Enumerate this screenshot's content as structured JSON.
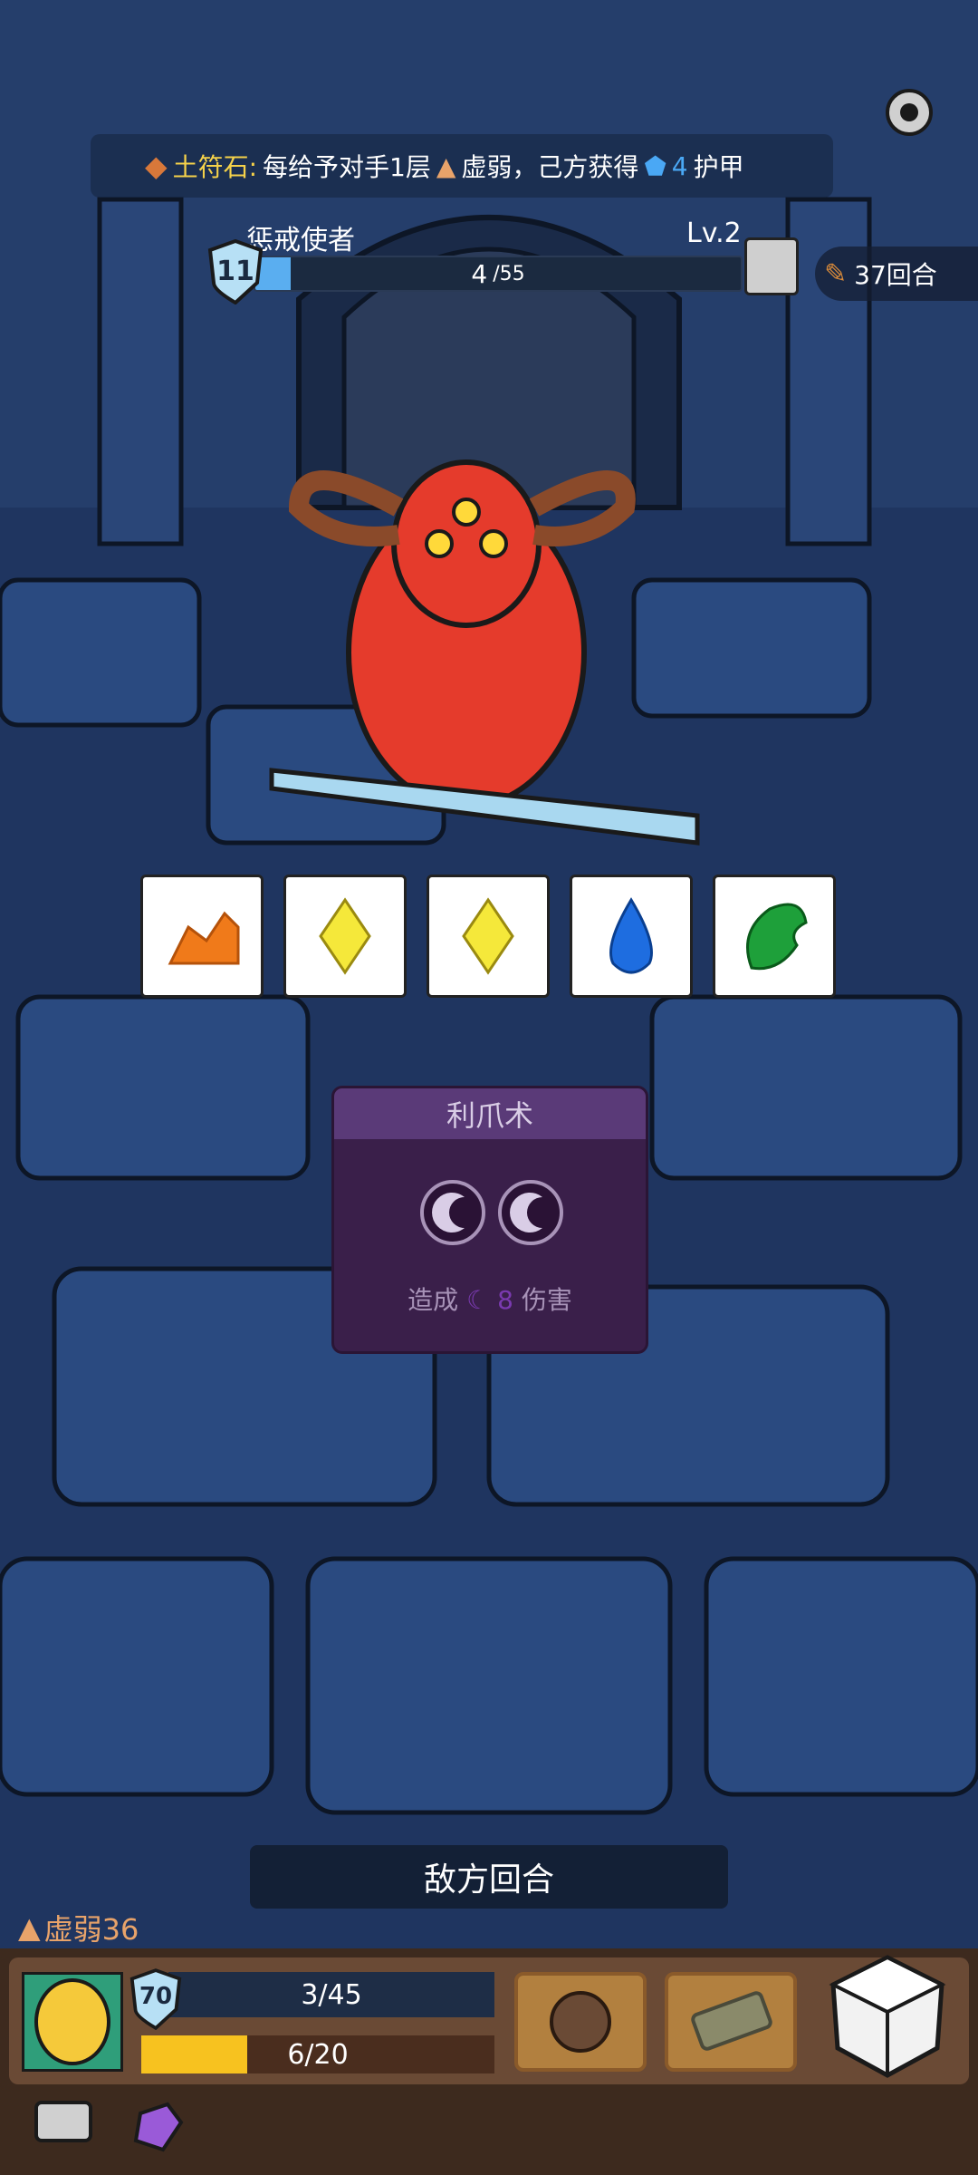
{
  "banner": {
    "label": "土符石:",
    "text1": "每给予对手1层",
    "text2": "虚弱，己方获得",
    "armor_value": "4",
    "text3": "护甲"
  },
  "enemy": {
    "name": "惩戒使者",
    "level": "Lv.2",
    "shield": "11",
    "hp_current": "4",
    "hp_max": "/55",
    "hp_fraction": 0.0727
  },
  "turns": {
    "label": "37回合"
  },
  "cards": [
    "earth-rune",
    "lightning-rune",
    "lightning-rune",
    "water-rune",
    "leaf-rune"
  ],
  "skill": {
    "title": "利爪术",
    "desc_prefix": "造成",
    "damage": "8",
    "desc_suffix": "伤害"
  },
  "turn_indicator": "敌方回合",
  "status": {
    "weak_label": "虚弱36"
  },
  "player": {
    "shield": "70",
    "hp": "3/45",
    "energy": "6/20",
    "energy_fraction": 0.3
  },
  "colors": {
    "background": "#1f3560",
    "accent_yellow": "#f5d24a",
    "hp_blue": "#5aaef0",
    "energy_yellow": "#f7c21f"
  }
}
